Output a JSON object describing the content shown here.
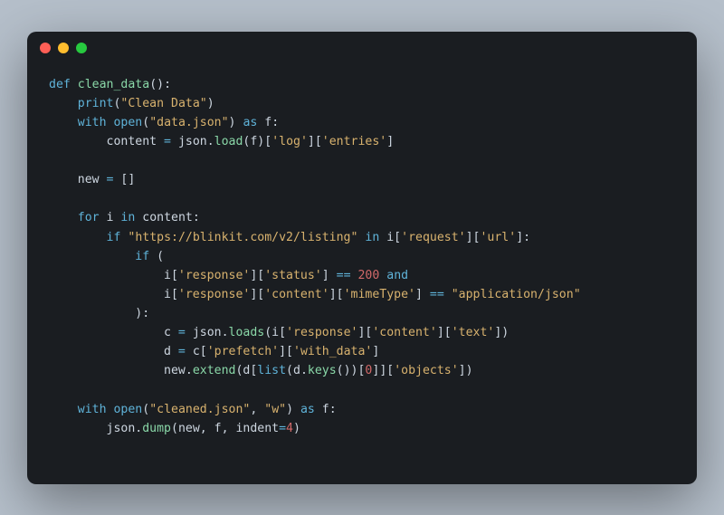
{
  "window": {
    "controls": [
      "close",
      "minimize",
      "maximize"
    ]
  },
  "code": {
    "tokens": [
      [
        [
          "kw",
          "def"
        ],
        [
          "pn",
          " "
        ],
        [
          "fn",
          "clean_data"
        ],
        [
          "pn",
          "():"
        ]
      ],
      [
        [
          "pn",
          "    "
        ],
        [
          "builtin",
          "print"
        ],
        [
          "pn",
          "("
        ],
        [
          "str",
          "\"Clean Data\""
        ],
        [
          "pn",
          ")"
        ]
      ],
      [
        [
          "pn",
          "    "
        ],
        [
          "kw",
          "with"
        ],
        [
          "pn",
          " "
        ],
        [
          "builtin",
          "open"
        ],
        [
          "pn",
          "("
        ],
        [
          "str",
          "\"data.json\""
        ],
        [
          "pn",
          ") "
        ],
        [
          "kw",
          "as"
        ],
        [
          "pn",
          " f:"
        ]
      ],
      [
        [
          "pn",
          "        content "
        ],
        [
          "op",
          "="
        ],
        [
          "pn",
          " json"
        ],
        [
          "dot-op",
          "."
        ],
        [
          "fn",
          "load"
        ],
        [
          "pn",
          "(f)["
        ],
        [
          "str",
          "'log'"
        ],
        [
          "pn",
          "]["
        ],
        [
          "str",
          "'entries'"
        ],
        [
          "pn",
          "]"
        ]
      ],
      [
        [
          "pn",
          ""
        ]
      ],
      [
        [
          "pn",
          "    new "
        ],
        [
          "op",
          "="
        ],
        [
          "pn",
          " []"
        ]
      ],
      [
        [
          "pn",
          ""
        ]
      ],
      [
        [
          "pn",
          "    "
        ],
        [
          "kw",
          "for"
        ],
        [
          "pn",
          " i "
        ],
        [
          "kw",
          "in"
        ],
        [
          "pn",
          " content:"
        ]
      ],
      [
        [
          "pn",
          "        "
        ],
        [
          "kw",
          "if"
        ],
        [
          "pn",
          " "
        ],
        [
          "str",
          "\"https://blinkit.com/v2/listing\""
        ],
        [
          "pn",
          " "
        ],
        [
          "kw",
          "in"
        ],
        [
          "pn",
          " i["
        ],
        [
          "str",
          "'request'"
        ],
        [
          "pn",
          "]["
        ],
        [
          "str",
          "'url'"
        ],
        [
          "pn",
          "]:"
        ]
      ],
      [
        [
          "pn",
          "            "
        ],
        [
          "kw",
          "if"
        ],
        [
          "pn",
          " ("
        ]
      ],
      [
        [
          "pn",
          "                i["
        ],
        [
          "str",
          "'response'"
        ],
        [
          "pn",
          "]["
        ],
        [
          "str",
          "'status'"
        ],
        [
          "pn",
          "] "
        ],
        [
          "op",
          "=="
        ],
        [
          "pn",
          " "
        ],
        [
          "num",
          "200"
        ],
        [
          "pn",
          " "
        ],
        [
          "kw",
          "and"
        ]
      ],
      [
        [
          "pn",
          "                i["
        ],
        [
          "str",
          "'response'"
        ],
        [
          "pn",
          "]["
        ],
        [
          "str",
          "'content'"
        ],
        [
          "pn",
          "]["
        ],
        [
          "str",
          "'mimeType'"
        ],
        [
          "pn",
          "] "
        ],
        [
          "op",
          "=="
        ],
        [
          "pn",
          " "
        ],
        [
          "str",
          "\"application/json\""
        ]
      ],
      [
        [
          "pn",
          "            ):"
        ]
      ],
      [
        [
          "pn",
          "                c "
        ],
        [
          "op",
          "="
        ],
        [
          "pn",
          " json"
        ],
        [
          "dot-op",
          "."
        ],
        [
          "fn",
          "loads"
        ],
        [
          "pn",
          "(i["
        ],
        [
          "str",
          "'response'"
        ],
        [
          "pn",
          "]["
        ],
        [
          "str",
          "'content'"
        ],
        [
          "pn",
          "]["
        ],
        [
          "str",
          "'text'"
        ],
        [
          "pn",
          "])"
        ]
      ],
      [
        [
          "pn",
          "                d "
        ],
        [
          "op",
          "="
        ],
        [
          "pn",
          " c["
        ],
        [
          "str",
          "'prefetch'"
        ],
        [
          "pn",
          "]["
        ],
        [
          "str",
          "'with_data'"
        ],
        [
          "pn",
          "]"
        ]
      ],
      [
        [
          "pn",
          "                new"
        ],
        [
          "dot-op",
          "."
        ],
        [
          "fn",
          "extend"
        ],
        [
          "pn",
          "(d["
        ],
        [
          "builtin",
          "list"
        ],
        [
          "pn",
          "(d"
        ],
        [
          "dot-op",
          "."
        ],
        [
          "fn",
          "keys"
        ],
        [
          "pn",
          "())["
        ],
        [
          "num",
          "0"
        ],
        [
          "pn",
          "]]["
        ],
        [
          "str",
          "'objects'"
        ],
        [
          "pn",
          "])"
        ]
      ],
      [
        [
          "pn",
          ""
        ]
      ],
      [
        [
          "pn",
          "    "
        ],
        [
          "kw",
          "with"
        ],
        [
          "pn",
          " "
        ],
        [
          "builtin",
          "open"
        ],
        [
          "pn",
          "("
        ],
        [
          "str",
          "\"cleaned.json\""
        ],
        [
          "pn",
          ", "
        ],
        [
          "str",
          "\"w\""
        ],
        [
          "pn",
          ") "
        ],
        [
          "kw",
          "as"
        ],
        [
          "pn",
          " f:"
        ]
      ],
      [
        [
          "pn",
          "        json"
        ],
        [
          "dot-op",
          "."
        ],
        [
          "fn",
          "dump"
        ],
        [
          "pn",
          "(new, f, indent"
        ],
        [
          "op",
          "="
        ],
        [
          "num",
          "4"
        ],
        [
          "pn",
          ")"
        ]
      ]
    ]
  }
}
